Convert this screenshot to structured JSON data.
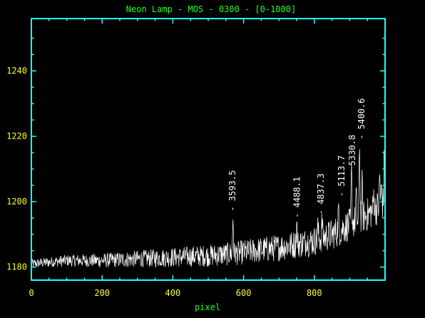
{
  "colors": {
    "background": "#000000",
    "title": "#20ff20",
    "frame": "#20ffff",
    "tick_labels": "#ffff20",
    "xlabel": "#20ff20",
    "trace": "#ffffff",
    "line_ids": "#ffffff"
  },
  "chart_data": {
    "type": "line",
    "title": "Neon Lamp - MOS - 0300 - [0-1000]",
    "xlabel": "pixel",
    "ylabel": "",
    "xlim": [
      0,
      1000
    ],
    "ylim": [
      1176,
      1256
    ],
    "xticks": [
      0,
      200,
      400,
      600,
      800
    ],
    "yticks": [
      1180,
      1200,
      1220,
      1240
    ],
    "grid": false,
    "legend": "none",
    "baseline": {
      "x": [
        0,
        100,
        200,
        300,
        400,
        500,
        560,
        600,
        700,
        800,
        850,
        900,
        950,
        1000
      ],
      "y": [
        1181,
        1182,
        1182,
        1182.5,
        1183,
        1183.5,
        1184,
        1184.5,
        1186,
        1188,
        1190,
        1193,
        1196,
        1200
      ]
    },
    "peaks": [
      {
        "x": 570,
        "y": 1195
      },
      {
        "x": 750,
        "y": 1193
      },
      {
        "x": 778,
        "y": 1189
      },
      {
        "x": 810,
        "y": 1192
      },
      {
        "x": 822,
        "y": 1194
      },
      {
        "x": 868,
        "y": 1197
      },
      {
        "x": 905,
        "y": 1209
      },
      {
        "x": 918,
        "y": 1202
      },
      {
        "x": 928,
        "y": 1217
      },
      {
        "x": 935,
        "y": 1205
      },
      {
        "x": 968,
        "y": 1202
      },
      {
        "x": 985,
        "y": 1208
      },
      {
        "x": 990,
        "y": 1204
      },
      {
        "x": 998,
        "y": 1215
      }
    ],
    "line_ids": [
      {
        "label": "- 3593.5",
        "x": 570,
        "y": 1197
      },
      {
        "label": "- 4488.1",
        "x": 752,
        "y": 1195
      },
      {
        "label": "- 4837.3",
        "x": 820,
        "y": 1196
      },
      {
        "label": "- 5113.7",
        "x": 878,
        "y": 1201.5
      },
      {
        "label": "5330.8",
        "x": 908,
        "y": 1211
      },
      {
        "label": "- 5400.6",
        "x": 934,
        "y": 1219
      }
    ]
  }
}
